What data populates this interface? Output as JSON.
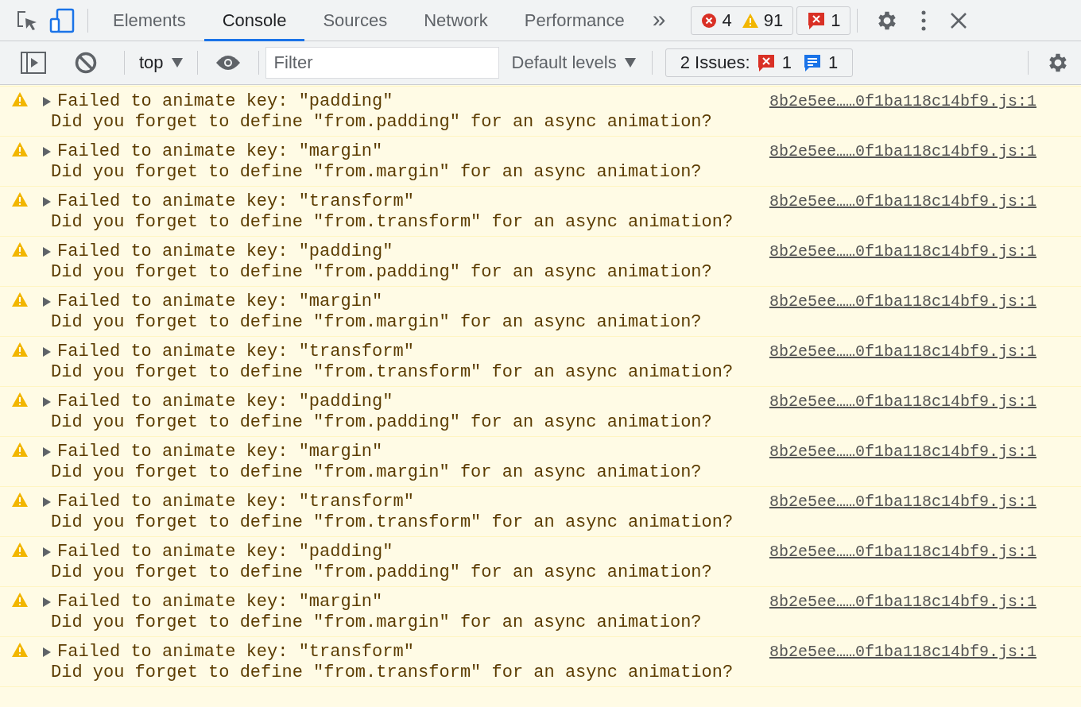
{
  "tabs": [
    {
      "label": "Elements",
      "selected": false
    },
    {
      "label": "Console",
      "selected": true
    },
    {
      "label": "Sources",
      "selected": false
    },
    {
      "label": "Network",
      "selected": false
    },
    {
      "label": "Performance",
      "selected": false
    }
  ],
  "more_tabs": "»",
  "counters": {
    "errors": "4",
    "warnings": "91",
    "issues": "1"
  },
  "console_toolbar": {
    "context": "top",
    "filter": {
      "placeholder": "Filter"
    },
    "levels": "Default levels",
    "issues": {
      "label": "2 Issues:",
      "errors": "1",
      "info": "1"
    }
  },
  "messages": [
    {
      "kind": "warning",
      "expanded": false,
      "text": "Failed to animate key: \"padding\"",
      "detail": "Did you forget to define \"from.padding\" for an async animation?",
      "source": "8b2e5ee……0f1ba118c14bf9.js:1"
    },
    {
      "kind": "warning",
      "expanded": false,
      "text": "Failed to animate key: \"margin\"",
      "detail": "Did you forget to define \"from.margin\" for an async animation?",
      "source": "8b2e5ee……0f1ba118c14bf9.js:1"
    },
    {
      "kind": "warning",
      "expanded": false,
      "text": "Failed to animate key: \"transform\"",
      "detail": "Did you forget to define \"from.transform\" for an async animation?",
      "source": "8b2e5ee……0f1ba118c14bf9.js:1"
    },
    {
      "kind": "warning",
      "expanded": false,
      "text": "Failed to animate key: \"padding\"",
      "detail": "Did you forget to define \"from.padding\" for an async animation?",
      "source": "8b2e5ee……0f1ba118c14bf9.js:1"
    },
    {
      "kind": "warning",
      "expanded": false,
      "text": "Failed to animate key: \"margin\"",
      "detail": "Did you forget to define \"from.margin\" for an async animation?",
      "source": "8b2e5ee……0f1ba118c14bf9.js:1"
    },
    {
      "kind": "warning",
      "expanded": false,
      "text": "Failed to animate key: \"transform\"",
      "detail": "Did you forget to define \"from.transform\" for an async animation?",
      "source": "8b2e5ee……0f1ba118c14bf9.js:1"
    },
    {
      "kind": "warning",
      "expanded": false,
      "text": "Failed to animate key: \"padding\"",
      "detail": "Did you forget to define \"from.padding\" for an async animation?",
      "source": "8b2e5ee……0f1ba118c14bf9.js:1"
    },
    {
      "kind": "warning",
      "expanded": false,
      "text": "Failed to animate key: \"margin\"",
      "detail": "Did you forget to define \"from.margin\" for an async animation?",
      "source": "8b2e5ee……0f1ba118c14bf9.js:1"
    },
    {
      "kind": "warning",
      "expanded": false,
      "text": "Failed to animate key: \"transform\"",
      "detail": "Did you forget to define \"from.transform\" for an async animation?",
      "source": "8b2e5ee……0f1ba118c14bf9.js:1"
    },
    {
      "kind": "warning",
      "expanded": false,
      "text": "Failed to animate key: \"padding\"",
      "detail": "Did you forget to define \"from.padding\" for an async animation?",
      "source": "8b2e5ee……0f1ba118c14bf9.js:1"
    },
    {
      "kind": "warning",
      "expanded": false,
      "text": "Failed to animate key: \"margin\"",
      "detail": "Did you forget to define \"from.margin\" for an async animation?",
      "source": "8b2e5ee……0f1ba118c14bf9.js:1"
    },
    {
      "kind": "warning",
      "expanded": false,
      "text": "Failed to animate key: \"transform\"",
      "detail": "Did you forget to define \"from.transform\" for an async animation?",
      "source": "8b2e5ee……0f1ba118c14bf9.js:1"
    }
  ]
}
